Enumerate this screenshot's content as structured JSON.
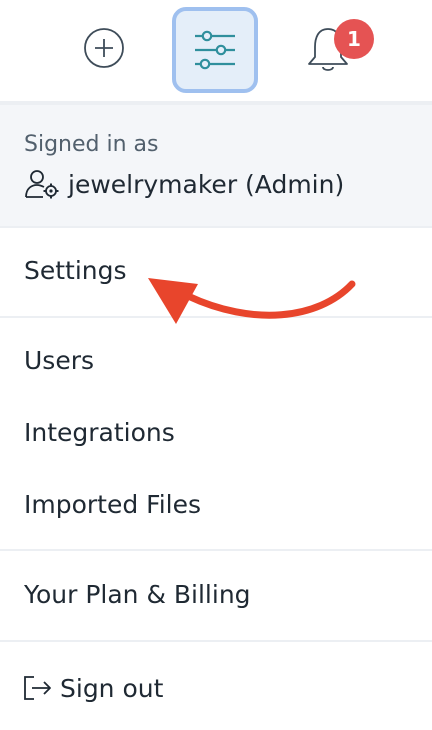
{
  "header": {
    "icons": [
      "plus-circle-icon",
      "sliders-icon",
      "bell-icon"
    ],
    "notification_count": "1"
  },
  "account": {
    "signed_in_caption": "Signed in as",
    "username": "jewelrymaker (Admin)"
  },
  "menu": {
    "settings": "Settings",
    "users": "Users",
    "integrations": "Integrations",
    "imported_files": "Imported Files",
    "plan_billing": "Your Plan & Billing",
    "sign_out": "Sign out"
  },
  "colors": {
    "accent_border": "#9fc0ef",
    "accent_bg": "#e4eef9",
    "badge": "#e55353",
    "annotation_arrow": "#e8452c"
  }
}
